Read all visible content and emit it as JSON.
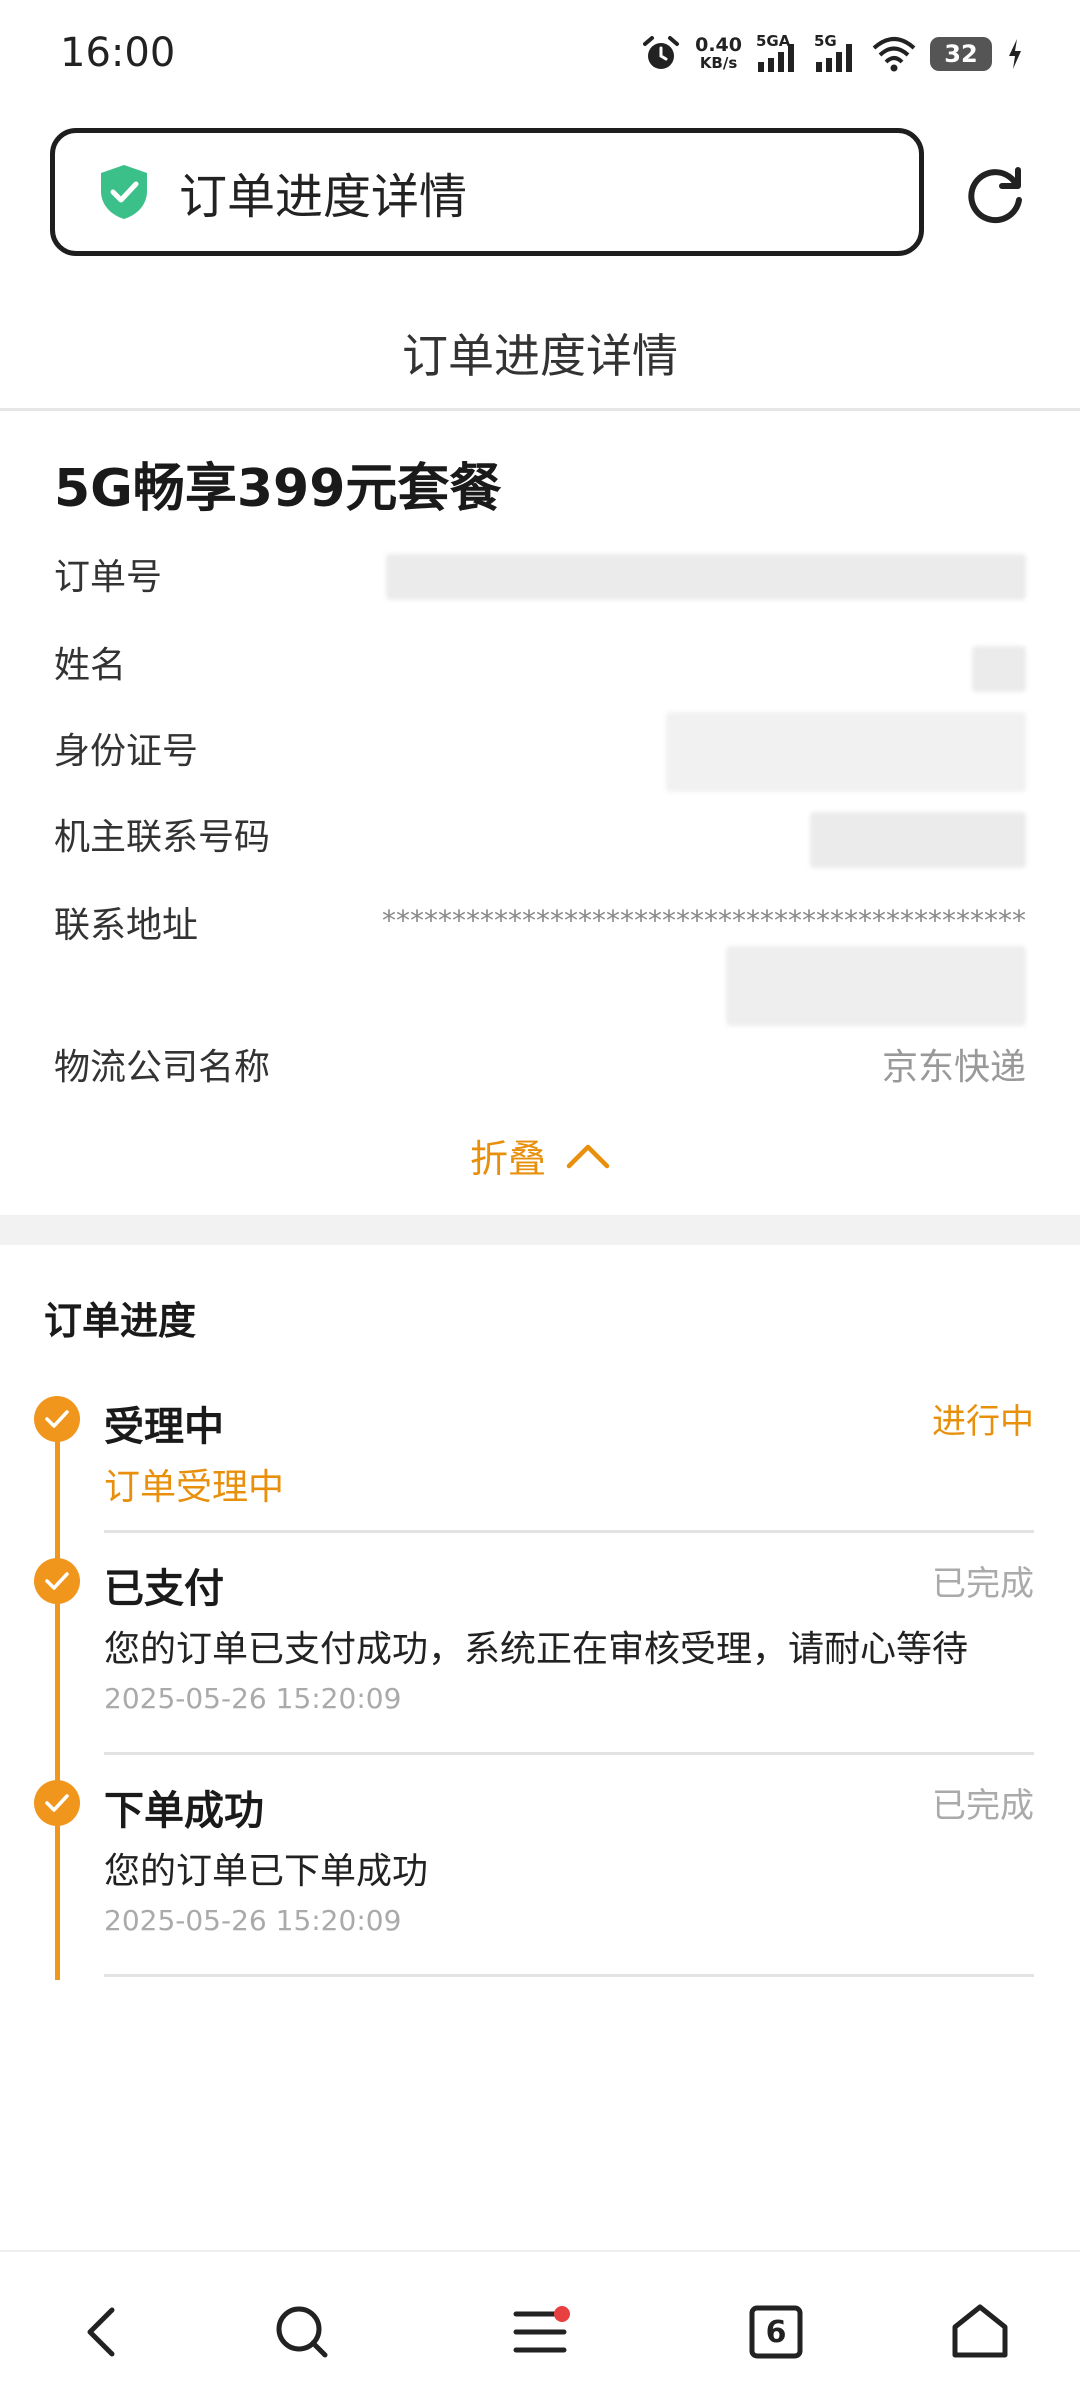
{
  "status_bar": {
    "time": "16:00",
    "net_speed_value": "0.40",
    "net_speed_unit": "KB/s",
    "sim1_label": "5GA",
    "sim2_label": "5G",
    "battery": "32"
  },
  "browser": {
    "url_title": "订单进度详情",
    "tab_count": "6"
  },
  "page": {
    "title": "订单进度详情"
  },
  "order": {
    "plan_name": "5G畅享399元套餐",
    "fields": [
      {
        "label": "订单号"
      },
      {
        "label": "姓名"
      },
      {
        "label": "身份证号"
      },
      {
        "label": "机主联系号码"
      },
      {
        "label": "联系地址",
        "value": "**********************************************"
      },
      {
        "label": "物流公司名称",
        "value": "京东快递"
      }
    ],
    "collapse_label": "折叠"
  },
  "progress": {
    "title": "订单进度",
    "steps": [
      {
        "title": "受理中",
        "state": "进行中",
        "desc": "订单受理中"
      },
      {
        "title": "已支付",
        "state": "已完成",
        "desc": "您的订单已支付成功，系统正在审核受理，请耐心等待",
        "time": "2025-05-26 15:20:09"
      },
      {
        "title": "下单成功",
        "state": "已完成",
        "desc": "您的订单已下单成功",
        "time": "2025-05-26 15:20:09"
      }
    ]
  },
  "colors": {
    "accent": "#f0961c",
    "shield": "#3cc08a"
  },
  "icons": {
    "back": "back-icon",
    "search": "search-icon",
    "menu": "menu-icon",
    "tabs": "tabs-icon",
    "home": "home-icon"
  }
}
